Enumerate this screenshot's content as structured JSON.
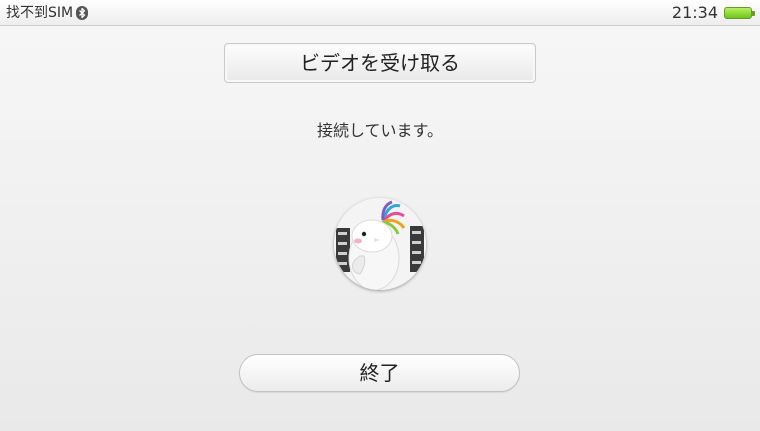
{
  "status_bar": {
    "carrier": "找不到SIM",
    "bluetooth_icon": "bluetooth-icon",
    "time": "21:34",
    "battery_icon": "battery-icon",
    "battery_color": "#6cc81a"
  },
  "main": {
    "title": "ビデオを受け取る",
    "status_message": "接続しています。",
    "avatar_icon": "avatar-icon"
  },
  "actions": {
    "end_label": "終了"
  }
}
